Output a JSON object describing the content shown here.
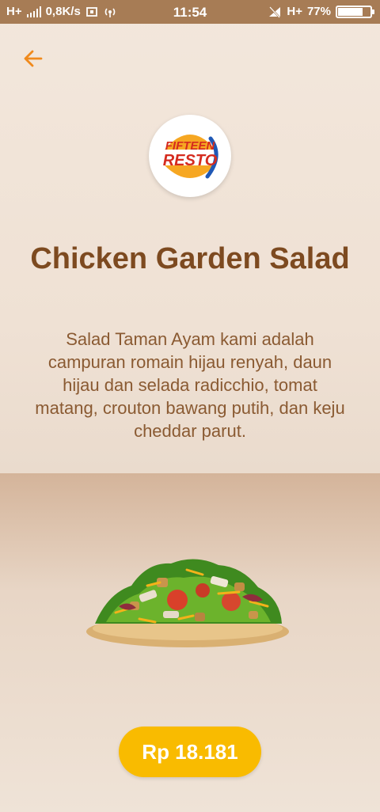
{
  "status_bar": {
    "network_left": "H+",
    "speed": "0,8K/s",
    "time": "11:54",
    "network_right": "H+",
    "battery": "77%",
    "battery_level": 0.77
  },
  "logo": {
    "line1": "FIFTEEN",
    "line2": "RESTO"
  },
  "product": {
    "title": "Chicken Garden Salad",
    "description": "Salad Taman Ayam kami adalah campuran romain hijau renyah, daun hijau dan selada radicchio, tomat matang, crouton bawang putih, dan keju cheddar parut.",
    "price_label": "Rp 18.181"
  },
  "colors": {
    "accent": "#f9bb00",
    "title": "#7d4a20",
    "back_arrow": "#f08a1c",
    "status_bar": "#a77c55"
  },
  "icons": {
    "back": "arrow-left-icon",
    "signal": "signal-icon",
    "screenshot": "screenshot-icon",
    "hotspot": "hotspot-icon",
    "mute": "mute-icon",
    "battery": "battery-icon"
  }
}
